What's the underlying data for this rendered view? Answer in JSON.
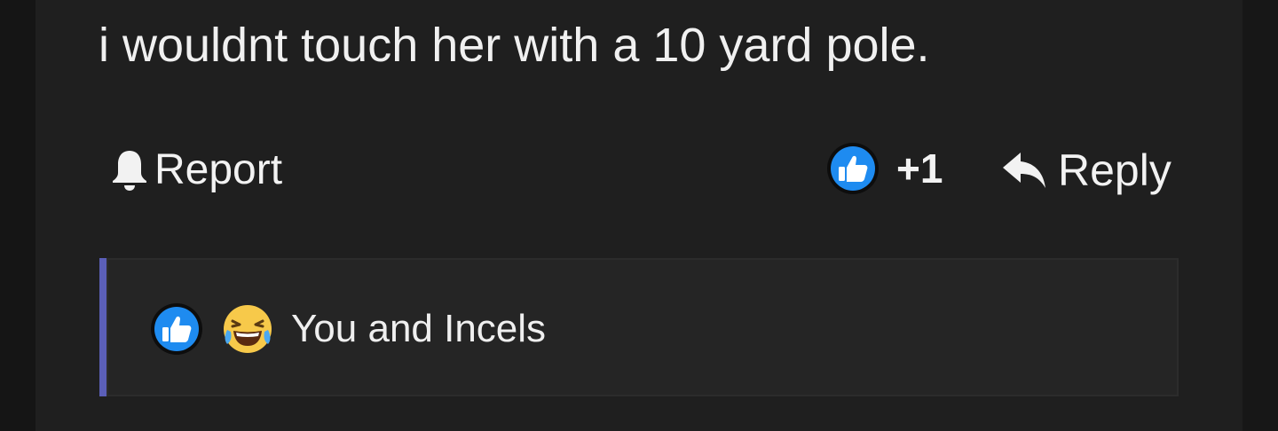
{
  "comment": {
    "text": "i wouldnt touch her with a 10 yard pole."
  },
  "actions": {
    "report_label": "Report",
    "report_icon": "bell-icon",
    "like_icon": "thumbs-up-icon",
    "like_count": "+1",
    "reply_label": "Reply",
    "reply_icon": "reply-arrow-icon"
  },
  "reactions": {
    "icons": [
      "thumbs-up-icon",
      "laughing-crying-emoji-icon"
    ],
    "summary": "You and Incels"
  },
  "colors": {
    "background": "#1f1f1f",
    "panel": "#252525",
    "accent_bar": "#5b5fb8",
    "like_blue": "#1e8bf0",
    "text": "#f0f0f0"
  }
}
